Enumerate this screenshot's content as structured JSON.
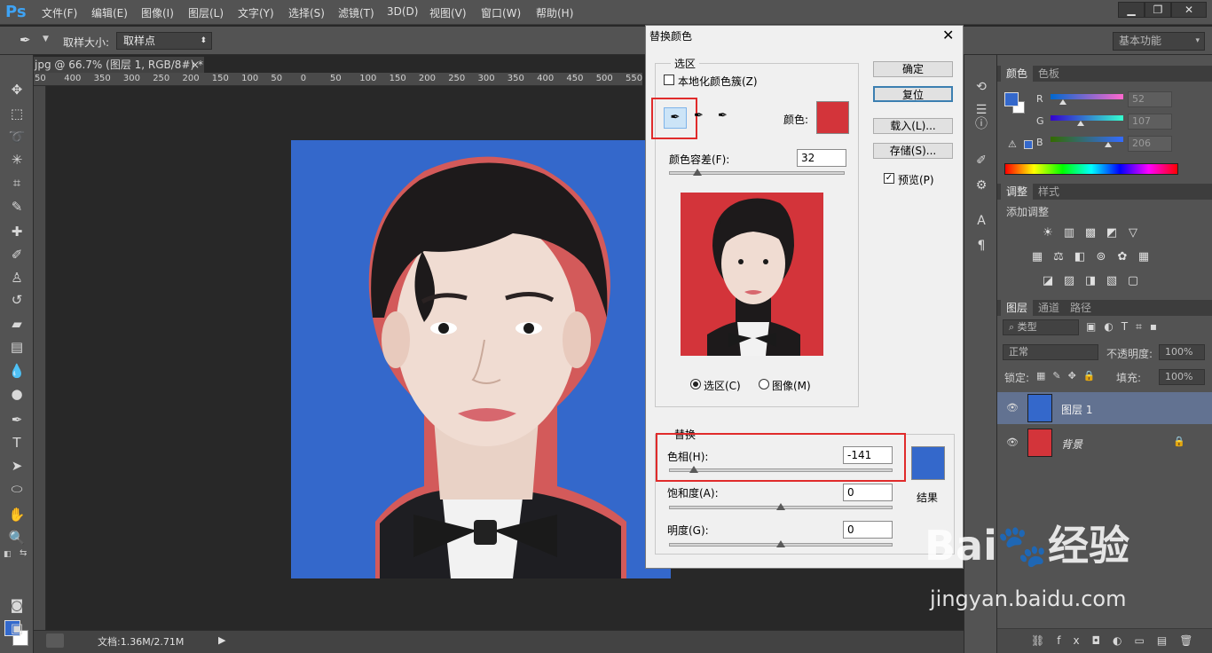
{
  "app": {
    "logo": "Ps"
  },
  "menu": [
    "文件(F)",
    "编辑(E)",
    "图像(I)",
    "图层(L)",
    "文字(Y)",
    "选择(S)",
    "滤镜(T)",
    "3D(D)",
    "视图(V)",
    "窗口(W)",
    "帮助(H)"
  ],
  "window_buttons": {
    "minimize": "▁",
    "restore": "❐",
    "close": "✕"
  },
  "options": {
    "sample_label": "取样大小:",
    "sample_value": "取样点",
    "workspace": "基本功能"
  },
  "document": {
    "tab_title": "jpg @ 66.7% (图层 1, RGB/8#) *",
    "ruler_ticks": [
      "50",
      "400",
      "350",
      "300",
      "250",
      "200",
      "150",
      "100",
      "50",
      "0",
      "50",
      "100",
      "150",
      "200",
      "250",
      "300",
      "350",
      "400",
      "450",
      "500",
      "550"
    ],
    "status_size": "文档:1.36M/2.71M"
  },
  "dialog": {
    "title": "替换颜色",
    "close": "✕",
    "selection_group": "选区",
    "localized_clusters": "本地化颜色簇(Z)",
    "color_label": "颜色:",
    "selection_color": "#d3343a",
    "fuzziness_label": "颜色容差(F):",
    "fuzziness_value": "32",
    "fuzziness_slider": 0.16,
    "radio_selection": "选区(C)",
    "radio_image": "图像(M)",
    "replace_group": "替换",
    "hue_label": "色相(H):",
    "hue_value": "-141",
    "hue_slider": 0.11,
    "saturation_label": "饱和度(A):",
    "saturation_value": "0",
    "saturation_slider": 0.5,
    "lightness_label": "明度(G):",
    "lightness_value": "0",
    "lightness_slider": 0.5,
    "result_label": "结果",
    "result_color": "#3468cb",
    "buttons": {
      "ok": "确定",
      "reset": "复位",
      "load": "载入(L)...",
      "save": "存储(S)..."
    },
    "preview_label": "预览(P)",
    "preview_checked": true,
    "localized_checked": false
  },
  "color_panel": {
    "tabs": [
      "颜色",
      "色板"
    ],
    "r_label": "R",
    "g_label": "G",
    "b_label": "B",
    "r_value": "52",
    "g_value": "107",
    "b_value": "206"
  },
  "adjustments_panel": {
    "tabs": [
      "调整",
      "样式"
    ],
    "title": "添加调整"
  },
  "layers_panel": {
    "tabs": [
      "图层",
      "通道",
      "路径"
    ],
    "filter": "类型",
    "blend_mode": "正常",
    "opacity_label": "不透明度:",
    "opacity_value": "100%",
    "lock_label": "锁定:",
    "fill_label": "填充:",
    "fill_value": "100%",
    "layers": [
      {
        "name": "图层 1",
        "selected": true
      },
      {
        "name": "背景",
        "locked": true
      }
    ]
  },
  "watermark": {
    "brand": "Bai",
    "brand_suffix": "经验",
    "url": "jingyan.baidu.com"
  },
  "colors": {
    "accent_blue": "#3468cb",
    "highlight_red": "#e02b2b",
    "photo_red": "#d3343a"
  }
}
